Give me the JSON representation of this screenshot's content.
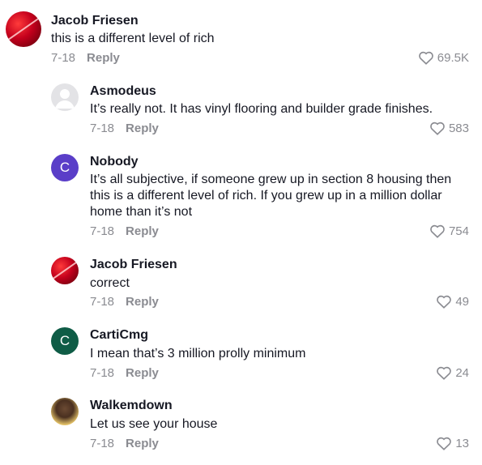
{
  "comments": [
    {
      "user": "Jacob Friesen",
      "text": "this is a different level of rich",
      "date": "7-18",
      "reply": "Reply",
      "likes": "69.5K",
      "avatar": "red-abstract-avatar"
    },
    {
      "user": "Asmodeus",
      "text": "It’s really not. It has vinyl flooring and builder grade finishes.",
      "date": "7-18",
      "reply": "Reply",
      "likes": "583",
      "avatar": "default-gray-avatar"
    },
    {
      "user": "Nobody",
      "text": "It’s all subjective, if someone grew up in section 8 housing then this is a different level of rich. If you grew up in a million dollar home than it’s not",
      "date": "7-18",
      "reply": "Reply",
      "likes": "754",
      "avatar_letter": "C"
    },
    {
      "user": "Jacob Friesen",
      "text": "correct",
      "date": "7-18",
      "reply": "Reply",
      "likes": "49",
      "avatar": "red-abstract-avatar"
    },
    {
      "user": "CartiCmg",
      "text": "I mean that’s 3 million prolly minimum",
      "date": "7-18",
      "reply": "Reply",
      "likes": "24",
      "avatar_letter": "C"
    },
    {
      "user": "Walkemdown",
      "text": "Let us see your house",
      "date": "7-18",
      "reply": "Reply",
      "likes": "13",
      "avatar": "photo-avatar"
    }
  ],
  "colors": {
    "text": "#161823",
    "muted": "#8a8b91",
    "purple": "#5a3ec8",
    "green": "#0f5c46"
  }
}
